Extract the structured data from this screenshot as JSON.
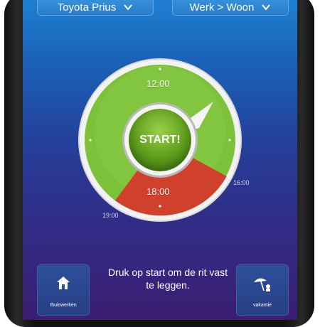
{
  "header": {
    "car_label": "Toyota Prius",
    "route_label": "Werk > Woon"
  },
  "dial": {
    "start_label": "START!",
    "top_time": "12:00",
    "bottom_time": "18:00",
    "right_time": "16:00",
    "left_time": "19:00"
  },
  "footer": {
    "instruction": "Druk op start om de rit vast te leggen.",
    "left_button_caption": "thuiswerken",
    "right_button_caption": "vakantie"
  },
  "colors": {
    "green": "#7cc13a",
    "red": "#d0412d",
    "background_top": "#1e7fd2",
    "background_bottom": "#3b1e72"
  },
  "icons": {
    "left": "house-icon",
    "right": "beach-umbrella-icon"
  }
}
